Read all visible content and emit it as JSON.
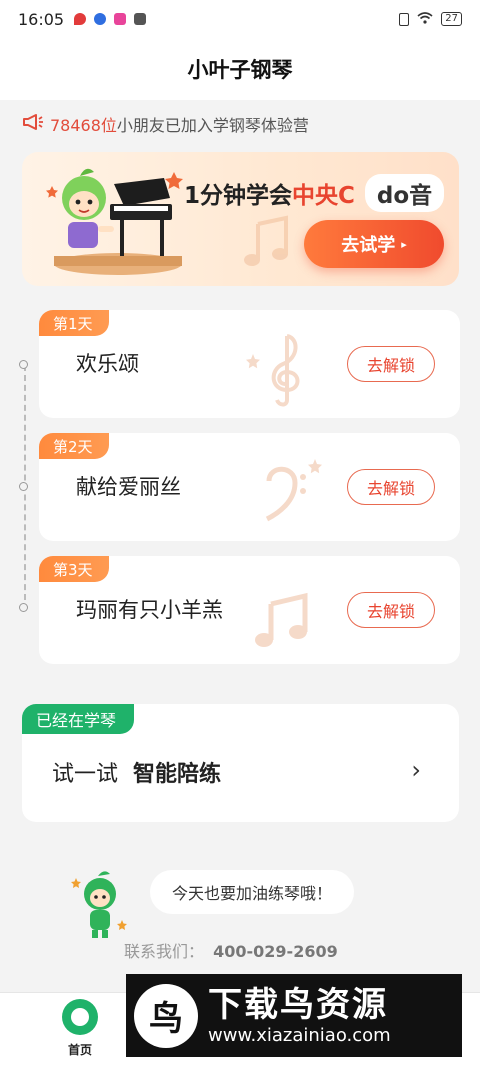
{
  "status_bar": {
    "time": "16:05",
    "battery": "27"
  },
  "header": {
    "title": "小叶子钢琴"
  },
  "notice": {
    "count": "78468位",
    "text": "小朋友已加入学钢琴体验营"
  },
  "banner": {
    "headline_prefix": "1分钟学会",
    "headline_accent": "中央C",
    "headline_pill": "do音",
    "button_label": "去试学",
    "button_arrow": "▸"
  },
  "lessons": [
    {
      "tag": "第1天",
      "name": "欢乐颂",
      "button": "去解锁"
    },
    {
      "tag": "第2天",
      "name": "献给爱丽丝",
      "button": "去解锁"
    },
    {
      "tag": "第3天",
      "name": "玛丽有只小羊羔",
      "button": "去解锁"
    }
  ],
  "practice": {
    "tag": "已经在学琴",
    "prefix": "试一试",
    "title": "智能陪练",
    "chevron": "›"
  },
  "cheer": {
    "bubble": "今天也要加油练琴哦！"
  },
  "contact": {
    "label": "联系我们：",
    "phone": "400-029-2609"
  },
  "bottom_nav": {
    "home_label": "首页"
  },
  "watermark": {
    "logo_glyph": "鸟",
    "title": "下载鸟资源",
    "url": "www.xiazainiao.com"
  },
  "colors": {
    "accent": "#e8442f",
    "orange": "#ff8a3d",
    "green": "#1fb26a"
  }
}
